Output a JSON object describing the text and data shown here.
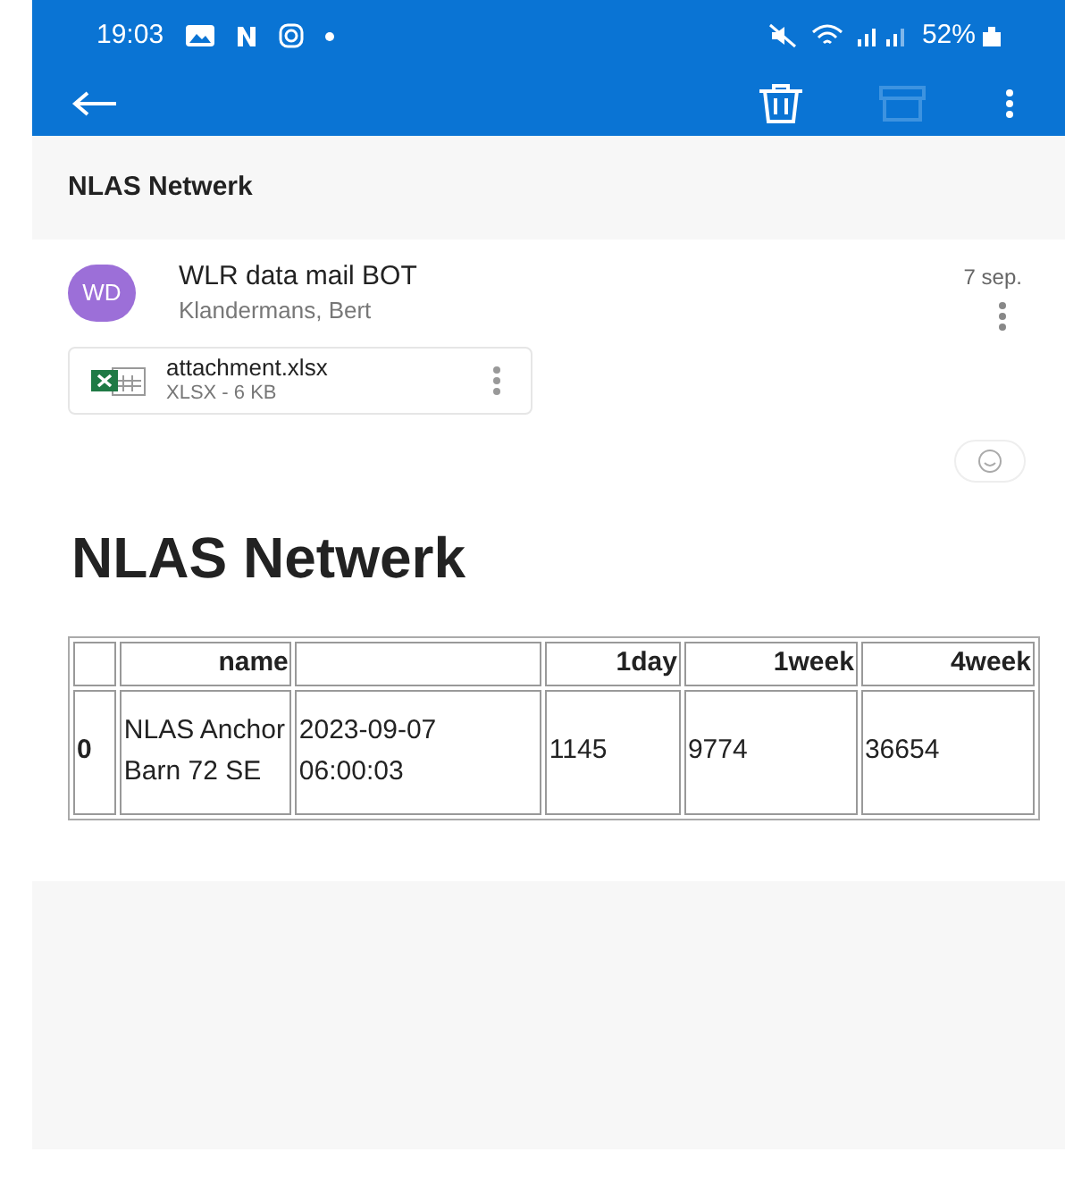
{
  "status_bar": {
    "time": "19:03",
    "battery": "52%"
  },
  "subject": "NLAS Netwerk",
  "message": {
    "avatar": "WD",
    "sender": "WLR data mail BOT",
    "recipient": "Klandermans, Bert",
    "date": "7 sep."
  },
  "attachment": {
    "name": "attachment.xlsx",
    "info": "XLSX - 6 KB"
  },
  "body": {
    "heading": "NLAS Netwerk",
    "table": {
      "columns": [
        "",
        "name",
        "",
        "1day",
        "1week",
        "4week"
      ],
      "rows": [
        [
          "0",
          "NLAS Anchor Barn 72 SE",
          "2023-09-07 06:00:03",
          "1145",
          "9774",
          "36654"
        ]
      ]
    }
  }
}
